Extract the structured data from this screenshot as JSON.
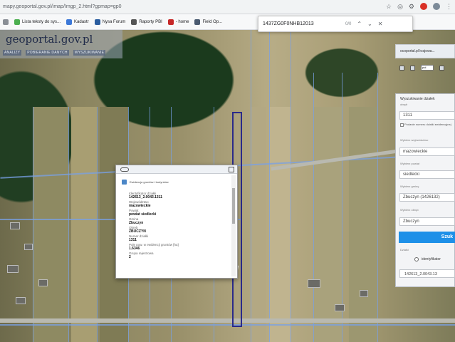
{
  "browser": {
    "url": "mapy.geoportal.gov.pl/imap/Imgp_2.html?gpmap=gp0"
  },
  "bookmarks": [
    {
      "label": "Lista teksty do sys...",
      "color": "#4caf50"
    },
    {
      "label": "Kadastr",
      "color": "#3c78d8"
    },
    {
      "label": "Nysa Forum",
      "color": "#2a5d9f"
    },
    {
      "label": "Raporty PBI",
      "color": "#555555"
    },
    {
      "label": "- home",
      "color": "#c62828"
    },
    {
      "label": "Field Op...",
      "color": "#4a5a70"
    }
  ],
  "find": {
    "query": "1437ZG0F0NHB12013",
    "count": "0/0"
  },
  "logo": {
    "text": "geoportal.gov.pl"
  },
  "map_menu": [
    "ANALIZY",
    "POBIERANIE DANYCH",
    "WYSZUKIWANIE"
  ],
  "popup": {
    "subtitle": "Ewidencja gruntów i budynków",
    "fields": [
      {
        "label": "Identyfikator działki",
        "value": "142613_2.0043.1311"
      },
      {
        "label": "Województwo",
        "value": "mazowieckie"
      },
      {
        "label": "Powiat",
        "value": "powiat siedlecki"
      },
      {
        "label": "Gmina",
        "value": "Zbuczyn"
      },
      {
        "label": "Obręb",
        "value": "ZBUCZYN"
      },
      {
        "label": "Numer działki",
        "value": "1311"
      },
      {
        "label": "Pole pow. w ewidencji gruntów [ha]",
        "value": "1.6346"
      },
      {
        "label": "Grupa rejestrowa",
        "value": "2"
      }
    ]
  },
  "right_panel": {
    "top_label": "ocoportal.pl krajowa...",
    "scale_select": "pol",
    "title": "Wyszukiwanie działek",
    "subtitle": "obręb",
    "parcel_number": "1311",
    "note": "Podanie numeru działki ewidencyjnej",
    "voivodeship_label": "Wybierz województwo",
    "voivodeship": "mazowieckie",
    "district_label": "Wybierz powiat",
    "district": "siedlecki",
    "commune_label": "Wybierz gminę",
    "commune": "Zbuczyn (1426132)",
    "precinct_label": "Wybierz obręb",
    "precinct": "Zbuczyn",
    "search_button": "Szuk",
    "results_label": "Działki",
    "radio_label": "identyfikator",
    "result_id": "142613_2.0043.13"
  }
}
